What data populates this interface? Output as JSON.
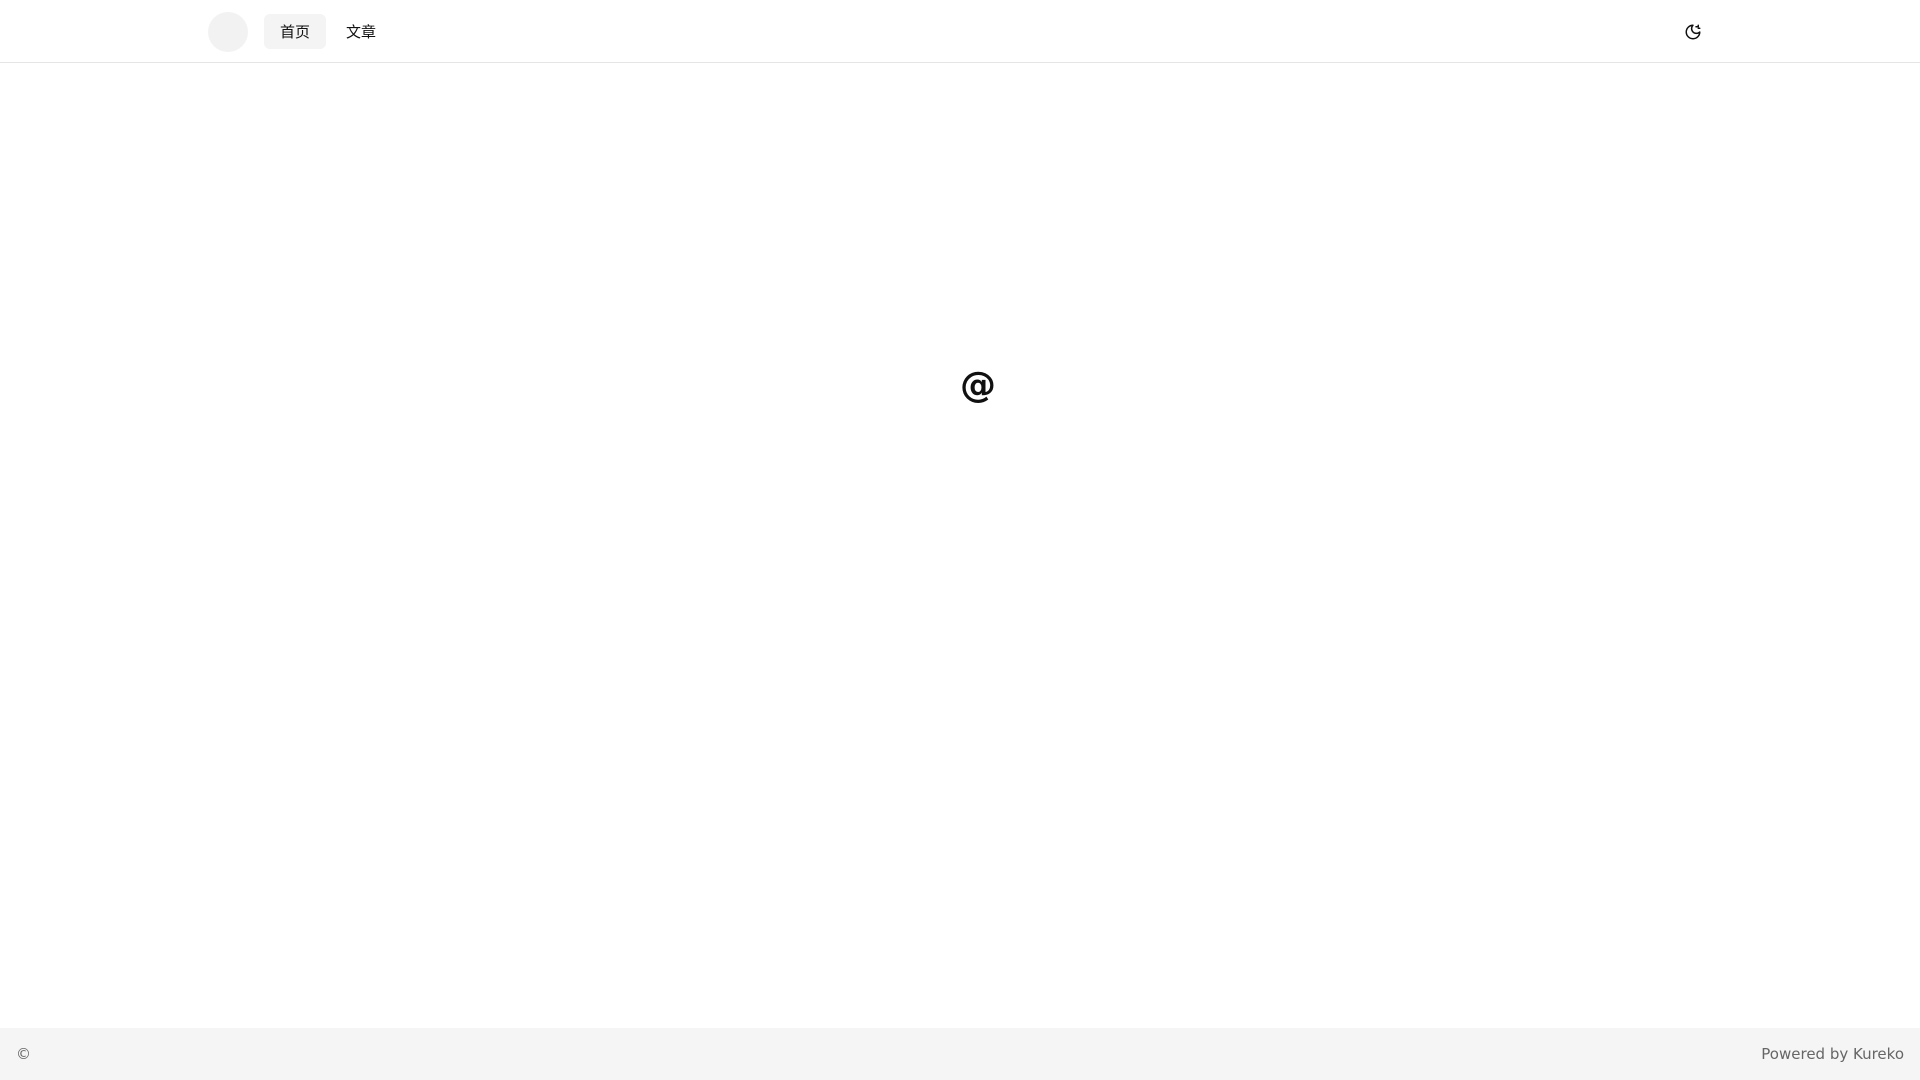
{
  "header": {
    "nav": [
      {
        "label": "首页",
        "active": true
      },
      {
        "label": "文章",
        "active": false
      }
    ],
    "theme_toggle_icon": "theme-toggle-moon-sun-icon"
  },
  "main": {
    "center_symbol": "@"
  },
  "footer": {
    "copyright": "©",
    "powered_by": "Powered by Kureko"
  },
  "colors": {
    "background": "#ffffff",
    "header_border": "#e5e5e5",
    "nav_active_bg": "#f4f4f4",
    "avatar_bg": "#f2f2f2",
    "footer_bg": "#f5f5f5",
    "footer_text": "#666666"
  }
}
